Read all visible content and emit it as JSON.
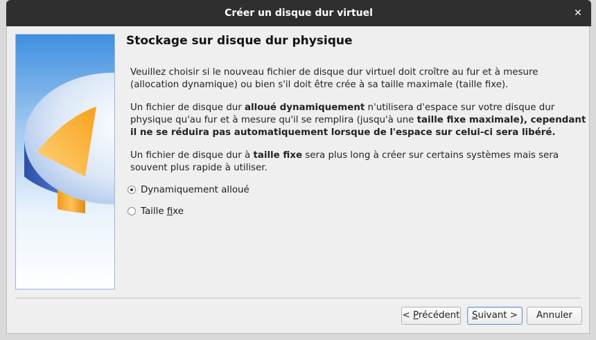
{
  "window": {
    "title": "Créer un disque dur virtuel",
    "close_icon": "close-icon"
  },
  "page": {
    "title": "Stockage sur disque dur physique",
    "p1": "Veuillez choisir si le nouveau fichier de disque dur virtuel doit croître au fur et à mesure (allocation dynamique) ou bien s'il doit être crée à sa taille maximale (taille fixe).",
    "p2": {
      "a": "Un fichier de disque dur ",
      "b": "alloué dynamiquement",
      "c": " n'utilisera d'espace sur votre disque dur physique qu'au fur et à mesure qu'il se remplira (jusqu'à une ",
      "d": "taille fixe maximale), cependant il ne se réduira pas automatiquement lorsque de l'espace sur celui-ci sera libéré."
    },
    "p3": {
      "a": "Un fichier de disque dur à ",
      "b": "taille fixe",
      "c": " sera plus long à créer sur certains systèmes mais sera souvent plus rapide à utiliser."
    }
  },
  "options": {
    "dynamic": {
      "label": "Dynamiquement alloué",
      "checked": true
    },
    "fixed": {
      "label_pre": "Taille ",
      "label_key": "f",
      "label_post": "ixe",
      "checked": false
    }
  },
  "buttons": {
    "prev": {
      "pre": "< ",
      "key": "P",
      "post": "récédent"
    },
    "next": {
      "key": "S",
      "post": "uivant >"
    },
    "cancel": "Annuler"
  },
  "colors": {
    "titlebar": "#2f2f2f",
    "window_bg": "#efefef",
    "disk_blue": "#4a74c9",
    "disk_orange": "#f7a21b"
  }
}
